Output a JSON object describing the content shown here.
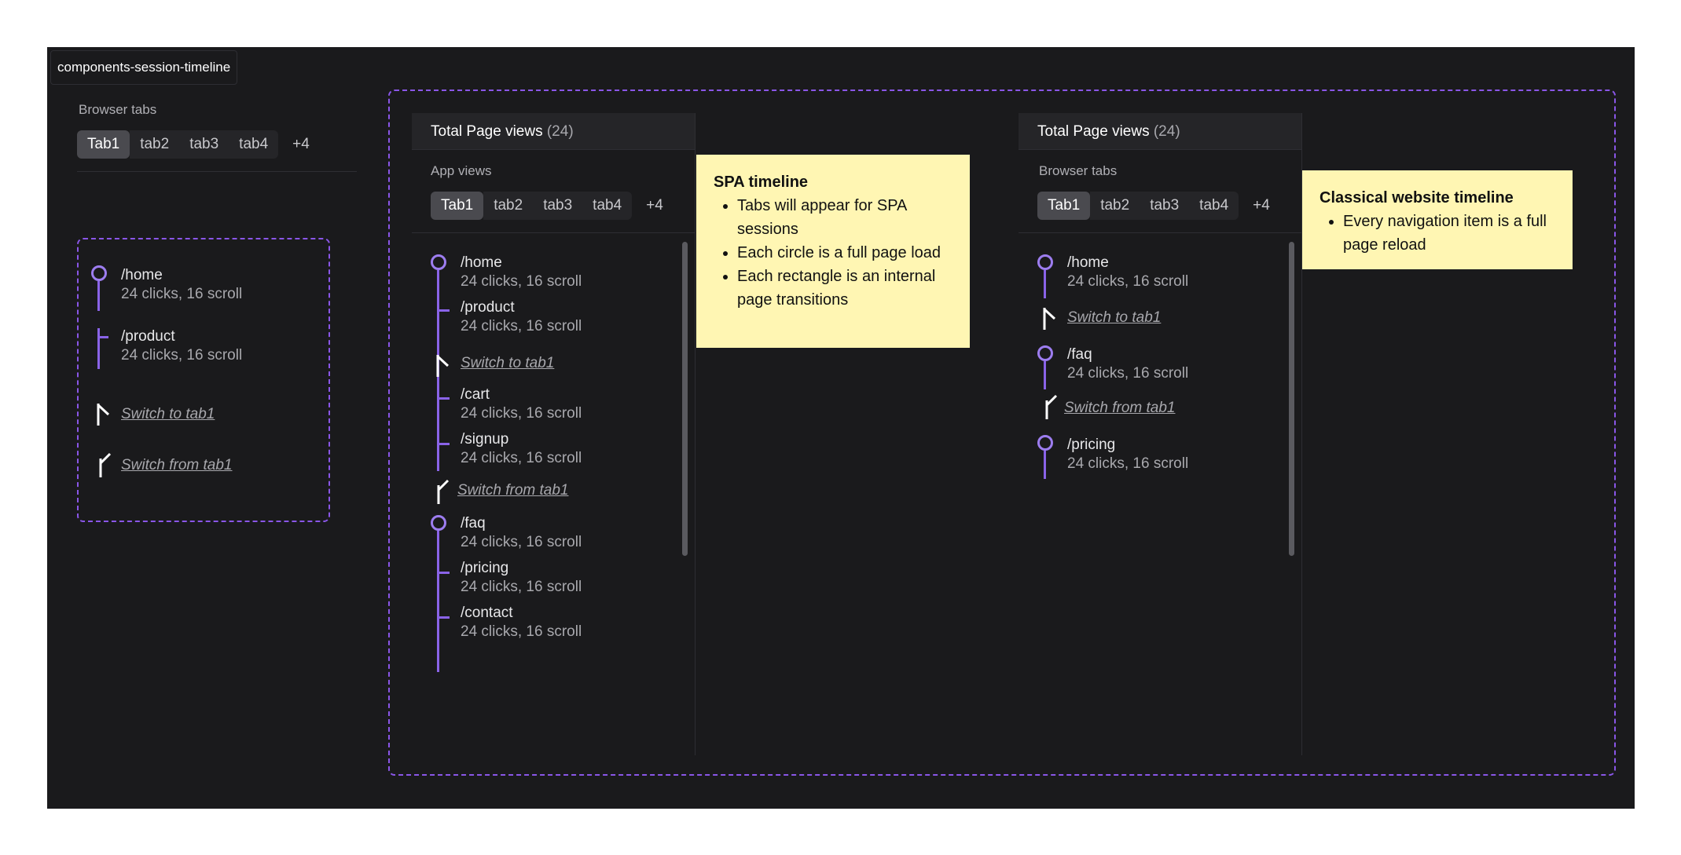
{
  "frame": {
    "label": "components-session-timeline"
  },
  "tabs": [
    "Tab1",
    "tab2",
    "tab3",
    "tab4"
  ],
  "more": "+4",
  "left": {
    "section_label": "Browser tabs",
    "items": [
      {
        "path": "/home",
        "stats": "24 clicks, 16 scroll"
      },
      {
        "path": "/product",
        "stats": "24 clicks, 16 scroll"
      }
    ],
    "switch_to": "Switch to tab1",
    "switch_from": "Switch from tab1"
  },
  "spa": {
    "header_title": "Total Page views",
    "header_count": "(24)",
    "section_label": "App views",
    "items": [
      {
        "path": "/home",
        "stats": "24 clicks, 16 scroll"
      },
      {
        "path": "/product",
        "stats": "24 clicks, 16 scroll"
      },
      {
        "path": "/cart",
        "stats": "24 clicks, 16 scroll"
      },
      {
        "path": "/signup",
        "stats": "24 clicks, 16 scroll"
      },
      {
        "path": "/faq",
        "stats": "24 clicks, 16 scroll"
      },
      {
        "path": "/pricing",
        "stats": "24 clicks, 16 scroll"
      },
      {
        "path": "/contact",
        "stats": "24 clicks, 16 scroll"
      }
    ],
    "switch_to": "Switch to tab1",
    "switch_from": "Switch from tab1"
  },
  "spa_note": {
    "title": "SPA timeline",
    "bullets": [
      "Tabs will appear for SPA sessions",
      "Each circle is a full page load",
      "Each rectangle is an internal page transitions"
    ]
  },
  "classic": {
    "header_title": "Total Page views",
    "header_count": "(24)",
    "section_label": "Browser tabs",
    "items": [
      {
        "path": "/home",
        "stats": "24 clicks, 16 scroll"
      },
      {
        "path": "/faq",
        "stats": "24 clicks, 16 scroll"
      },
      {
        "path": "/pricing",
        "stats": "24 clicks, 16 scroll"
      }
    ],
    "switch_to": "Switch to tab1",
    "switch_from": "Switch from tab1"
  },
  "classic_note": {
    "title": "Classical website timeline",
    "bullets": [
      "Every navigation item is a full page reload"
    ]
  },
  "colors": {
    "accent": "#8a63e8",
    "note_bg": "#fff6b3",
    "frame_bg": "#1a1a1c"
  }
}
